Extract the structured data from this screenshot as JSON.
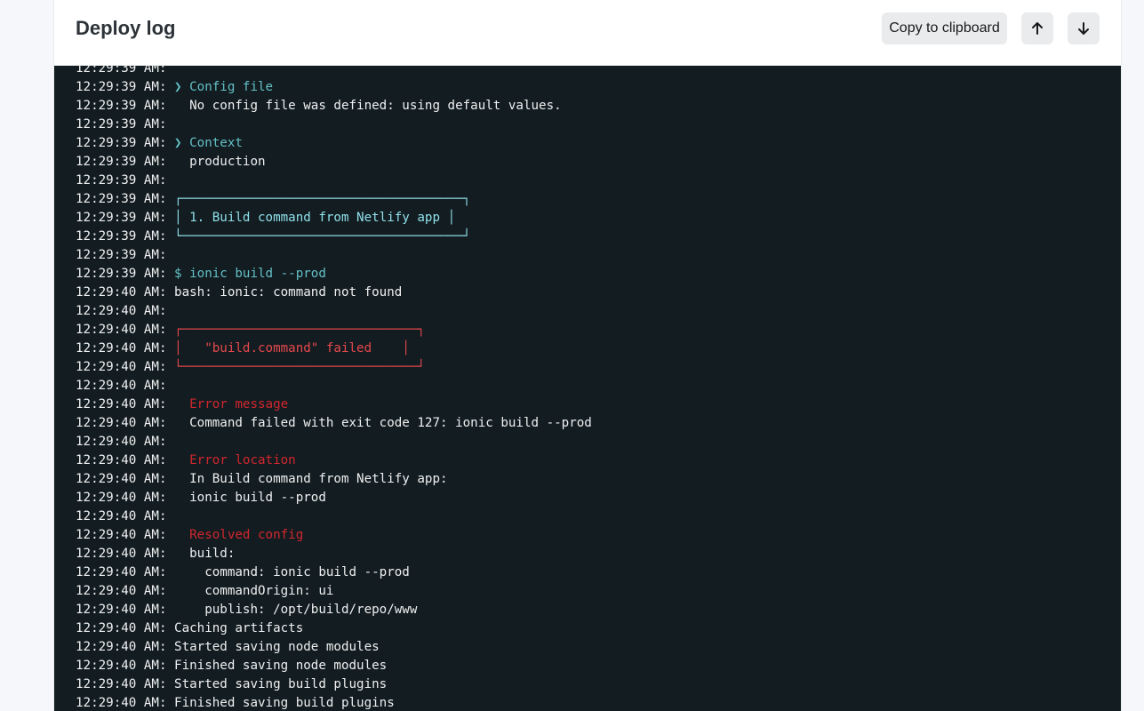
{
  "header": {
    "title": "Deploy log",
    "copy_label": "Copy to clipboard",
    "scroll_top_icon": "arrow-up-icon",
    "scroll_bottom_icon": "arrow-down-icon"
  },
  "colors": {
    "terminal_bg": "#131c20",
    "text": "#eef0f1",
    "teal": "#62c0c7",
    "cyan": "#8ee0ea",
    "red": "#e5484d",
    "dark_red": "#d1272f"
  },
  "log": [
    {
      "time": "12:29:39 AM:",
      "text": "",
      "color": "default"
    },
    {
      "time": "12:29:39 AM:",
      "text": "❯ Config file",
      "color": "teal"
    },
    {
      "time": "12:29:39 AM:",
      "text": "  No config file was defined: using default values.",
      "color": "default"
    },
    {
      "time": "12:29:39 AM:",
      "text": "",
      "color": "default"
    },
    {
      "time": "12:29:39 AM:",
      "text": "❯ Context",
      "color": "teal"
    },
    {
      "time": "12:29:39 AM:",
      "text": "  production",
      "color": "default"
    },
    {
      "time": "12:29:39 AM:",
      "text": "",
      "color": "default"
    },
    {
      "time": "12:29:39 AM:",
      "text": "┌─────────────────────────────────────┐",
      "color": "cyan"
    },
    {
      "time": "12:29:39 AM:",
      "text": "│ 1. Build command from Netlify app │",
      "color": "cyan"
    },
    {
      "time": "12:29:39 AM:",
      "text": "└─────────────────────────────────────┘",
      "color": "cyan"
    },
    {
      "time": "12:29:39 AM:",
      "text": "",
      "color": "default"
    },
    {
      "time": "12:29:39 AM:",
      "text": "$ ionic build --prod",
      "color": "teal"
    },
    {
      "time": "12:29:40 AM:",
      "text": "bash: ionic: command not found",
      "color": "default"
    },
    {
      "time": "12:29:40 AM:",
      "text": "",
      "color": "default"
    },
    {
      "time": "12:29:40 AM:",
      "text": "┌───────────────────────────────┐",
      "color": "red"
    },
    {
      "time": "12:29:40 AM:",
      "text": "│   \"build.command\" failed    │",
      "color": "red"
    },
    {
      "time": "12:29:40 AM:",
      "text": "└───────────────────────────────┘",
      "color": "red"
    },
    {
      "time": "12:29:40 AM:",
      "text": "",
      "color": "default"
    },
    {
      "time": "12:29:40 AM:",
      "text": "  Error message",
      "color": "darkred"
    },
    {
      "time": "12:29:40 AM:",
      "text": "  Command failed with exit code 127: ionic build --prod",
      "color": "default"
    },
    {
      "time": "12:29:40 AM:",
      "text": "",
      "color": "default"
    },
    {
      "time": "12:29:40 AM:",
      "text": "  Error location",
      "color": "darkred"
    },
    {
      "time": "12:29:40 AM:",
      "text": "  In Build command from Netlify app:",
      "color": "default"
    },
    {
      "time": "12:29:40 AM:",
      "text": "  ionic build --prod",
      "color": "default"
    },
    {
      "time": "12:29:40 AM:",
      "text": "",
      "color": "default"
    },
    {
      "time": "12:29:40 AM:",
      "text": "  Resolved config",
      "color": "darkred"
    },
    {
      "time": "12:29:40 AM:",
      "text": "  build:",
      "color": "default"
    },
    {
      "time": "12:29:40 AM:",
      "text": "    command: ionic build --prod",
      "color": "default"
    },
    {
      "time": "12:29:40 AM:",
      "text": "    commandOrigin: ui",
      "color": "default"
    },
    {
      "time": "12:29:40 AM:",
      "text": "    publish: /opt/build/repo/www",
      "color": "default"
    },
    {
      "time": "12:29:40 AM:",
      "text": "Caching artifacts",
      "color": "default"
    },
    {
      "time": "12:29:40 AM:",
      "text": "Started saving node modules",
      "color": "default"
    },
    {
      "time": "12:29:40 AM:",
      "text": "Finished saving node modules",
      "color": "default"
    },
    {
      "time": "12:29:40 AM:",
      "text": "Started saving build plugins",
      "color": "default"
    },
    {
      "time": "12:29:40 AM:",
      "text": "Finished saving build plugins",
      "color": "default"
    }
  ]
}
